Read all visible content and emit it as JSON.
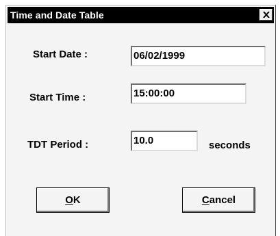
{
  "window": {
    "title": "Time and Date Table",
    "close_icon": "close-icon"
  },
  "form": {
    "start_date_label": "Start Date :",
    "start_date_value": "06/02/1999",
    "start_time_label": "Start Time :",
    "start_time_value": "15:00:00",
    "tdt_period_label": "TDT Period :",
    "tdt_period_value": "10.0",
    "tdt_period_unit": "seconds"
  },
  "buttons": {
    "ok_accel": "O",
    "ok_rest": "K",
    "cancel_accel": "C",
    "cancel_rest": "ancel"
  }
}
